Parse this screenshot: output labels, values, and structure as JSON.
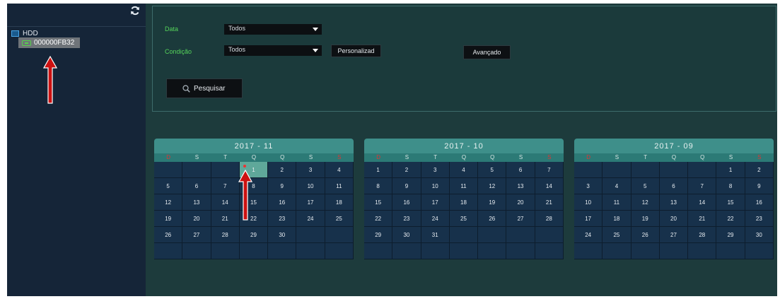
{
  "sidebar": {
    "tree": {
      "root_label": "HDD",
      "disk_label": "000000FB32"
    }
  },
  "filters": {
    "data_label": "Data",
    "data_value": "Todos",
    "condicao_label": "Condição",
    "condicao_value": "Todos",
    "personalized_button": "Personalizad",
    "advanced_button": "Avançado",
    "search_button": "Pesquisar"
  },
  "calendars": [
    {
      "title": "2017 - 11",
      "weekdays": [
        "D",
        "S",
        "T",
        "Q",
        "Q",
        "S",
        "S"
      ],
      "cells": [
        "",
        "",
        "",
        "1",
        "2",
        "3",
        "4",
        "5",
        "6",
        "7",
        "8",
        "9",
        "10",
        "11",
        "12",
        "13",
        "14",
        "15",
        "16",
        "17",
        "18",
        "19",
        "20",
        "21",
        "22",
        "23",
        "24",
        "25",
        "26",
        "27",
        "28",
        "29",
        "30",
        "",
        "",
        "",
        "",
        "",
        "",
        "",
        "",
        ""
      ],
      "selected": "1"
    },
    {
      "title": "2017 - 10",
      "weekdays": [
        "D",
        "S",
        "T",
        "Q",
        "Q",
        "S",
        "S"
      ],
      "cells": [
        "1",
        "2",
        "3",
        "4",
        "5",
        "6",
        "7",
        "8",
        "9",
        "10",
        "11",
        "12",
        "13",
        "14",
        "15",
        "16",
        "17",
        "18",
        "19",
        "20",
        "21",
        "22",
        "23",
        "24",
        "25",
        "26",
        "27",
        "28",
        "29",
        "30",
        "31",
        "",
        "",
        "",
        "",
        "",
        "",
        "",
        "",
        "",
        "",
        ""
      ],
      "selected": ""
    },
    {
      "title": "2017 - 09",
      "weekdays": [
        "D",
        "S",
        "T",
        "Q",
        "Q",
        "S",
        "S"
      ],
      "cells": [
        "",
        "",
        "",
        "",
        "",
        "1",
        "2",
        "3",
        "4",
        "5",
        "6",
        "7",
        "8",
        "9",
        "10",
        "11",
        "12",
        "13",
        "14",
        "15",
        "16",
        "17",
        "18",
        "19",
        "20",
        "21",
        "22",
        "23",
        "24",
        "25",
        "26",
        "27",
        "28",
        "29",
        "30",
        "",
        "",
        "",
        "",
        "",
        "",
        ""
      ],
      "selected": ""
    }
  ],
  "colors": {
    "panel_bg": "#1d3b3c",
    "sidebar_bg": "#152538",
    "label_green": "#55d45a",
    "calendar_header": "#3e8f8a",
    "weekend_red": "#e03434",
    "annotation_red": "#cc1111"
  }
}
